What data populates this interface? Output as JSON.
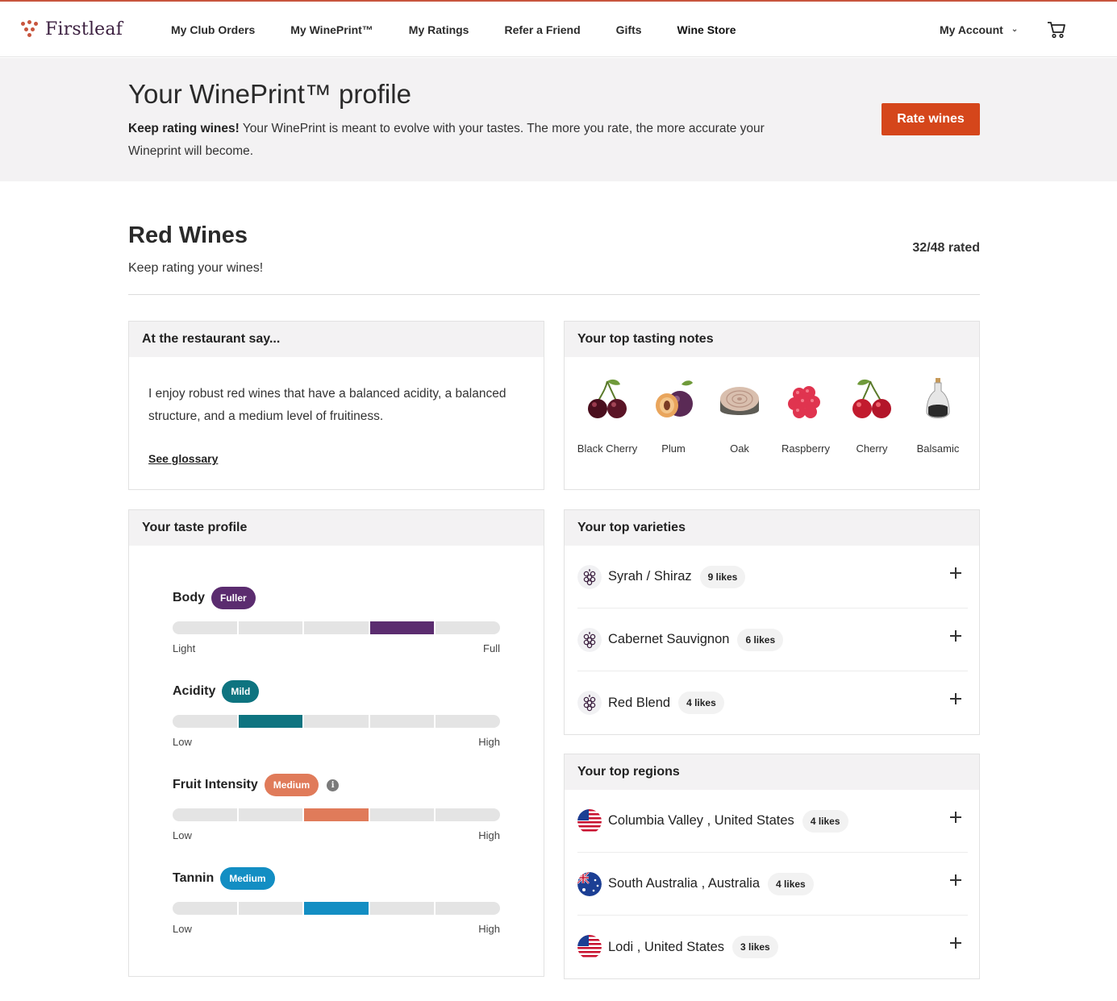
{
  "nav": {
    "logo_text": "Firstleaf",
    "links": [
      "My Club Orders",
      "My WinePrint™",
      "My Ratings",
      "Refer a Friend",
      "Gifts",
      "Wine Store"
    ],
    "account_label": "My Account"
  },
  "hero": {
    "title": "Your WinePrint™ profile",
    "lead_bold": "Keep rating wines!",
    "lead_text": " Your WinePrint is meant to evolve with your tastes. The more you rate, the more accurate your Wineprint will become.",
    "rate_button": "Rate wines"
  },
  "section": {
    "title": "Red Wines",
    "subtitle": "Keep rating your wines!",
    "rated": "32/48 rated"
  },
  "restaurant": {
    "heading": "At the restaurant say...",
    "text": "I enjoy robust red wines that have a balanced acidity, a balanced structure, and a medium level of fruitiness.",
    "link": "See glossary"
  },
  "notes": {
    "heading": "Your top tasting notes",
    "items": [
      {
        "label": "Black Cherry",
        "icon": "black-cherry-icon"
      },
      {
        "label": "Plum",
        "icon": "plum-icon"
      },
      {
        "label": "Oak",
        "icon": "oak-icon"
      },
      {
        "label": "Raspberry",
        "icon": "raspberry-icon"
      },
      {
        "label": "Cherry",
        "icon": "cherry-icon"
      },
      {
        "label": "Balsamic",
        "icon": "balsamic-icon"
      }
    ]
  },
  "taste": {
    "heading": "Your taste profile",
    "attributes": [
      {
        "name": "Body",
        "badge": "Fuller",
        "color": "#5b2c6f",
        "level": 4,
        "segments": 5,
        "low": "Light",
        "high": "Full"
      },
      {
        "name": "Acidity",
        "badge": "Mild",
        "color": "#0e7480",
        "level": 2,
        "segments": 5,
        "low": "Low",
        "high": "High"
      },
      {
        "name": "Fruit Intensity",
        "badge": "Medium",
        "color": "#e07b5a",
        "level": 3,
        "segments": 5,
        "low": "Low",
        "high": "High",
        "info": "i"
      },
      {
        "name": "Tannin",
        "badge": "Medium",
        "color": "#138ec3",
        "level": 3,
        "segments": 5,
        "low": "Low",
        "high": "High"
      }
    ]
  },
  "varieties": {
    "heading": "Your top varieties",
    "items": [
      {
        "name": "Syrah / Shiraz",
        "likes": "9 likes"
      },
      {
        "name": "Cabernet Sauvignon",
        "likes": "6 likes"
      },
      {
        "name": "Red Blend",
        "likes": "4 likes"
      }
    ]
  },
  "regions": {
    "heading": "Your top regions",
    "items": [
      {
        "name": "Columbia Valley , United States",
        "likes": "4 likes",
        "flag": "us-flag-icon"
      },
      {
        "name": "South Australia , Australia",
        "likes": "4 likes",
        "flag": "au-flag-icon"
      },
      {
        "name": "Lodi , United States",
        "likes": "3 likes",
        "flag": "us-flag-icon"
      }
    ]
  },
  "colors": {
    "accent": "#d5461b",
    "hero_bg": "#f3f2f3",
    "logo": "#3b1f3f"
  }
}
